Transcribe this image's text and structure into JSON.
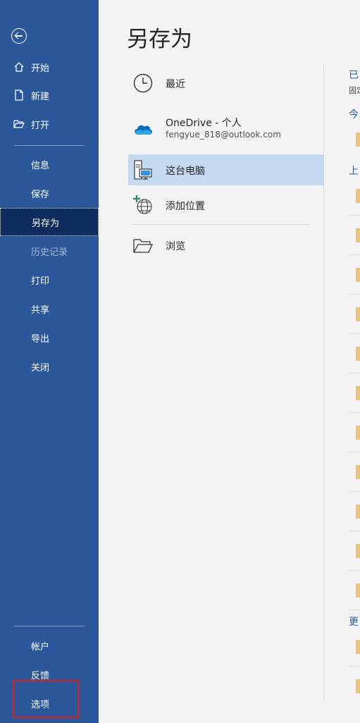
{
  "nav": {
    "back_icon": "back-arrow-icon",
    "items": [
      {
        "label": "开始",
        "icon": "home-icon"
      },
      {
        "label": "新建",
        "icon": "new-document-icon"
      },
      {
        "label": "打开",
        "icon": "open-folder-icon"
      },
      {
        "label": "信息"
      },
      {
        "label": "保存"
      },
      {
        "label": "另存为"
      },
      {
        "label": "历史记录"
      },
      {
        "label": "打印"
      },
      {
        "label": "共享"
      },
      {
        "label": "导出"
      },
      {
        "label": "关闭"
      }
    ],
    "bottom": [
      {
        "label": "帐户"
      },
      {
        "label": "反馈"
      },
      {
        "label": "选项"
      }
    ]
  },
  "main": {
    "title": "另存为",
    "locations": [
      {
        "label": "最近",
        "icon": "clock-icon"
      },
      {
        "label": "OneDrive - 个人",
        "sub": "fengyue_818@outlook.com",
        "icon": "onedrive-cloud-icon"
      },
      {
        "label": "这台电脑",
        "icon": "this-pc-icon"
      },
      {
        "label": "添加位置",
        "icon": "add-location-globe-icon"
      },
      {
        "label": "浏览",
        "icon": "browse-folder-icon"
      }
    ]
  },
  "right": {
    "heading": "已",
    "subheading": "固定",
    "group_today": "今",
    "group_lastweek": "上",
    "group_older": "更"
  },
  "colors": {
    "nav_bg": "#2b579a",
    "nav_active": "#0f2c5e",
    "selected_location": "#c5d9f1",
    "highlight_box": "#e11d1d",
    "folder": "#e8c57a"
  }
}
